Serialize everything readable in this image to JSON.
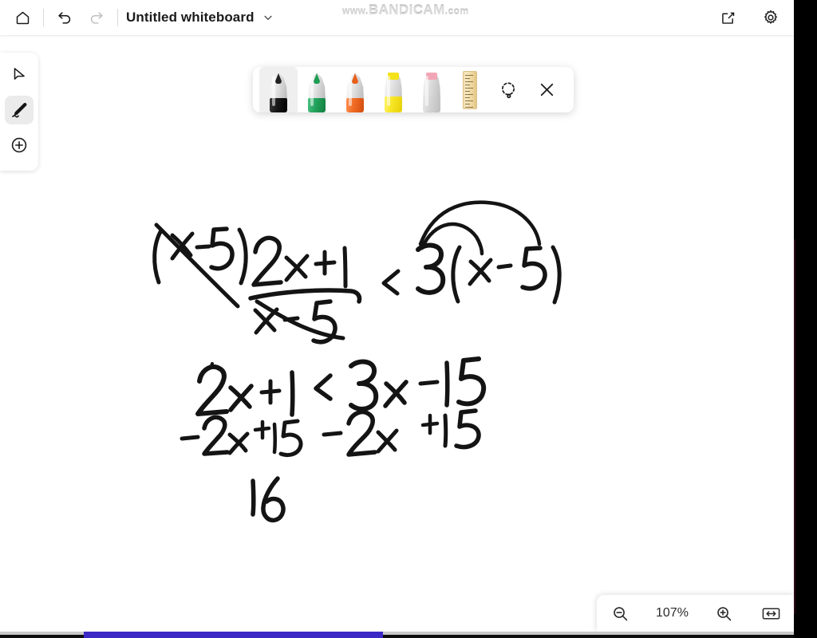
{
  "app": {
    "title": "Untitled whiteboard",
    "watermark_prefix": "www.",
    "watermark_brand": "BANDICAM",
    "watermark_suffix": ".com"
  },
  "topbar": {
    "home_label": "Home",
    "undo_label": "Undo",
    "redo_label": "Redo",
    "title": "Untitled whiteboard",
    "title_menu_label": "Open whiteboard menu",
    "share_label": "Share",
    "settings_label": "Settings"
  },
  "rail": {
    "items": [
      {
        "id": "select",
        "label": "Select",
        "icon": "cursor-arrow-icon",
        "active": false
      },
      {
        "id": "pen",
        "label": "Pen",
        "icon": "pen-icon",
        "active": true
      },
      {
        "id": "insert",
        "label": "Insert",
        "icon": "plus-circle-icon",
        "active": false
      }
    ]
  },
  "pen_toolbar": {
    "pens": [
      {
        "id": "black-pen",
        "label": "Black pen",
        "color": "#1a1a1a",
        "selected": true,
        "type": "pen"
      },
      {
        "id": "green-pen",
        "label": "Green pen",
        "color": "#1f9d55",
        "selected": false,
        "type": "pen"
      },
      {
        "id": "orange-pen",
        "label": "Orange pen",
        "color": "#e8601c",
        "selected": false,
        "type": "pen"
      },
      {
        "id": "yellow-highlighter",
        "label": "Yellow highlighter",
        "color": "#f4e21a",
        "selected": false,
        "type": "highlighter"
      },
      {
        "id": "pink-highlighter",
        "label": "Pink highlighter",
        "color": "#f2a6b5",
        "selected": false,
        "type": "highlighter"
      }
    ],
    "ruler_label": "Ruler",
    "lasso_label": "Lasso select",
    "close_label": "Close pen toolbar"
  },
  "zoom": {
    "out_label": "Zoom out",
    "level": "107%",
    "in_label": "Zoom in",
    "fit_label": "Fit to screen"
  },
  "whiteboard": {
    "description": "Handwritten algebra work solving a rational inequality",
    "lines": [
      {
        "id": "line-1",
        "text": "(x-5) · (2x+1)/(x-5) < 3(x-5)",
        "note": "matching (x-5) factors cancelled with diagonal strike-through; distribution arcs drawn from 3 to x and to -5"
      },
      {
        "id": "line-2",
        "text": "2x + 1 < 3x - 15"
      },
      {
        "id": "line-3",
        "text": "-2x +15      -2x   +15"
      },
      {
        "id": "line-4",
        "text": "16"
      }
    ]
  }
}
